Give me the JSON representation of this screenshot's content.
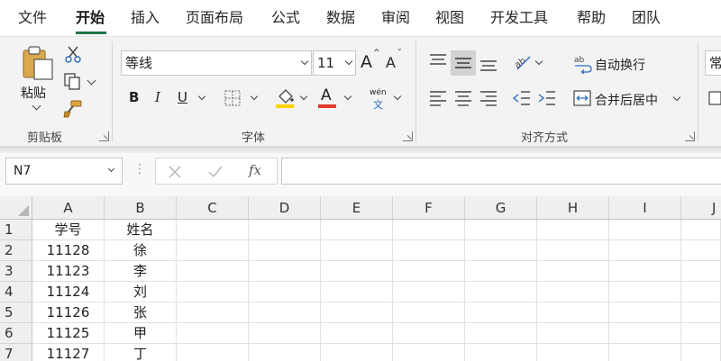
{
  "menu": {
    "tabs": [
      "文件",
      "开始",
      "插入",
      "页面布局",
      "公式",
      "数据",
      "审阅",
      "视图",
      "开发工具",
      "帮助",
      "团队"
    ],
    "active_index": 1
  },
  "ribbon": {
    "clipboard": {
      "paste_label": "粘贴",
      "group_label": "剪贴板"
    },
    "font": {
      "font_name": "等线",
      "font_size": "11",
      "bold": "B",
      "italic": "I",
      "underline": "U",
      "phonetic_top": "wén",
      "phonetic_bottom": "文",
      "group_label": "字体"
    },
    "alignment": {
      "wrap_text": "自动换行",
      "merge_center": "合并后居中",
      "group_label": "对齐方式"
    },
    "number": {
      "format_partial": "常"
    }
  },
  "formula_bar": {
    "name_box": "N7",
    "fx": "fx"
  },
  "sheet": {
    "columns": [
      "A",
      "B",
      "C",
      "D",
      "E",
      "F",
      "G",
      "H",
      "I",
      "J"
    ],
    "rows": [
      {
        "num": "1",
        "a": "学号",
        "b": "姓名"
      },
      {
        "num": "2",
        "a": "11128",
        "b": "徐"
      },
      {
        "num": "3",
        "a": "11123",
        "b": "李"
      },
      {
        "num": "4",
        "a": "11124",
        "b": "刘"
      },
      {
        "num": "5",
        "a": "11126",
        "b": "张"
      },
      {
        "num": "6",
        "a": "11125",
        "b": "甲"
      },
      {
        "num": "7",
        "a": "11127",
        "b": "丁"
      }
    ]
  },
  "colors": {
    "accent": "#217346",
    "fill_yellow": "#ffd200",
    "font_red": "#e23b2e"
  }
}
